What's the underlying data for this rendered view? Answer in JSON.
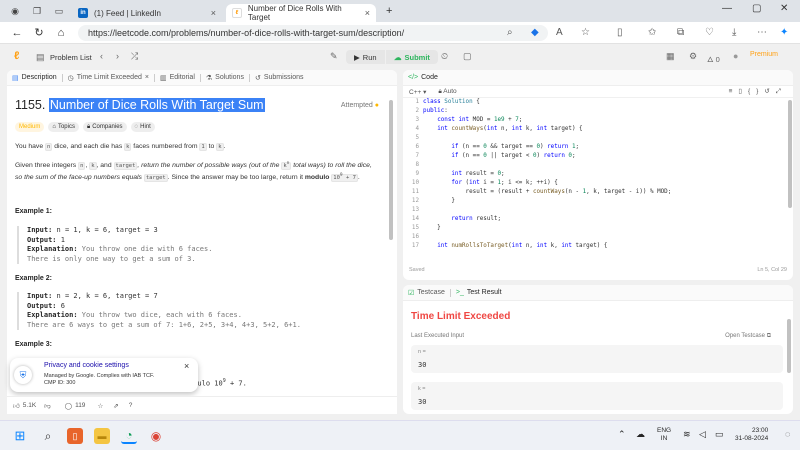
{
  "browser": {
    "tabs": [
      {
        "label": "(1) Feed | LinkedIn",
        "icon": "linkedin-icon"
      },
      {
        "label": "Number of Dice Rolls With Target",
        "icon": "leetcode-icon"
      }
    ],
    "new_tab": "+",
    "url": "https://leetcode.com/problems/number-of-dice-rolls-with-target-sum/description/"
  },
  "lc_header": {
    "problem_list": "Problem List",
    "run": "Run",
    "submit": "Submit",
    "streak": "0",
    "premium": "Premium"
  },
  "left_tabs": [
    "Description",
    "Time Limit Exceeded",
    "Editorial",
    "Solutions",
    "Submissions"
  ],
  "problem": {
    "number": "1155.",
    "title": "Number of Dice Rolls With Target Sum",
    "status": "Attempted",
    "chips": [
      "Medium",
      "Topics",
      "Companies",
      "Hint"
    ],
    "desc1_a": "You have ",
    "desc1_n": "n",
    "desc1_b": " dice, and each die has ",
    "desc1_k": "k",
    "desc1_c": " faces numbered from ",
    "desc1_1": "1",
    "desc1_d": " to ",
    "desc1_k2": "k",
    "desc1_e": ".",
    "desc2_a": "Given three integers ",
    "desc2_n": "n",
    "desc2_k": "k",
    "desc2_and": ", and ",
    "desc2_t": "target",
    "desc2_b": ", return the number of possible ways (out of the ",
    "desc2_kn": "k",
    "desc2_sup": "n",
    "desc2_c": " total ways) to roll the dice,",
    "desc3_a": "so the sum of the face-up numbers equals ",
    "desc3_t": "target",
    "desc3_b": ". Since the answer may be too large, return it ",
    "desc3_mod": "modulo",
    "desc3_num": "10",
    "desc3_sup": "9",
    "desc3_plus": " + 7",
    "desc3_end": "."
  },
  "examples": [
    {
      "heading": "Example 1:",
      "input": "n = 1, k = 6, target = 3",
      "output": "1",
      "expl1": "You throw one die with 6 faces.",
      "expl2": "There is only one way to get a sum of 3."
    },
    {
      "heading": "Example 2:",
      "input": "n = 2, k = 6, target = 7",
      "output": "6",
      "expl1": "You throw two dice, each with 6 faces.",
      "expl2": "There are 6 ways to get a sum of 7: 1+6, 2+5, 3+4, 4+3, 5+2, 6+1."
    },
    {
      "heading": "Example 3:"
    }
  ],
  "labels": {
    "input": "Input:",
    "output": "Output:",
    "explanation": "Explanation:"
  },
  "ex3_partial": {
    "line1": "Inpu",
    "tail": "odulo 10",
    "sup": "9",
    "end": " + 7."
  },
  "cookie": {
    "title": "Privacy and cookie settings",
    "line1": "Managed by Google. Complies with IAB TCF.",
    "line2": "CMP ID: 300",
    "close": "×"
  },
  "footer": {
    "likes": "5.1K",
    "comments": "119"
  },
  "code_panel": {
    "title": "Code",
    "lang": "C++",
    "mode": "Auto",
    "saved": "Saved",
    "cursor": "Ln 5, Col 29"
  },
  "code_lines": [
    {
      "n": "1",
      "t": "class Solution {"
    },
    {
      "n": "2",
      "t": "public:"
    },
    {
      "n": "3",
      "t": "    const int MOD = 1e9 + 7;"
    },
    {
      "n": "4",
      "t": "    int countWays(int n, int k, int target) {"
    },
    {
      "n": "5",
      "t": ""
    },
    {
      "n": "6",
      "t": "        if (n == 0 && target == 0) return 1;"
    },
    {
      "n": "7",
      "t": "        if (n == 0 || target < 0) return 0;"
    },
    {
      "n": "8",
      "t": ""
    },
    {
      "n": "9",
      "t": "        int result = 0;"
    },
    {
      "n": "10",
      "t": "        for (int i = 1; i <= k; ++i) {"
    },
    {
      "n": "11",
      "t": "            result = (result + countWays(n - 1, k, target - i)) % MOD;"
    },
    {
      "n": "12",
      "t": "        }"
    },
    {
      "n": "13",
      "t": ""
    },
    {
      "n": "14",
      "t": "        return result;"
    },
    {
      "n": "15",
      "t": "    }"
    },
    {
      "n": "16",
      "t": ""
    },
    {
      "n": "17",
      "t": "    int numRollsToTarget(int n, int k, int target) {"
    }
  ],
  "result_panel": {
    "tab1": "Testcase",
    "tab2": "Test Result",
    "verdict": "Time Limit Exceeded",
    "last_input": "Last Executed Input",
    "open_tc": "Open Testcase",
    "fields": [
      {
        "label": "n =",
        "value": "30"
      },
      {
        "label": "k =",
        "value": "30"
      }
    ]
  },
  "taskbar": {
    "lang1": "ENG",
    "lang2": "IN",
    "time": "23:00",
    "date": "31-08-2024"
  },
  "colors": {
    "accent": "#ffa116",
    "submit": "#2db55d",
    "error": "#ef4743",
    "highlight": "#3b82f6"
  }
}
